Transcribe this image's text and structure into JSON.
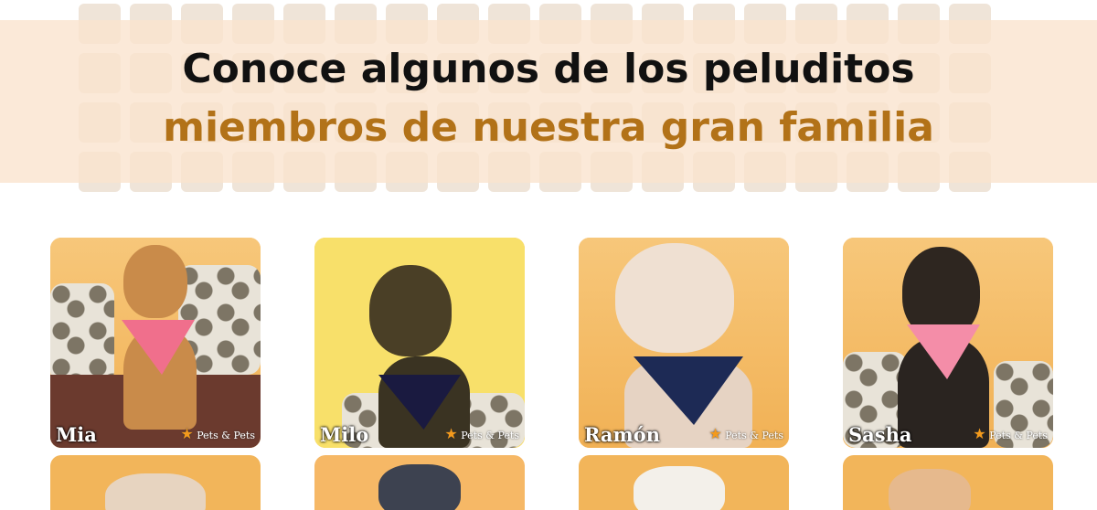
{
  "header": {
    "line1": "Conoce algunos de los peluditos",
    "line2": "miembros de nuestra gran familia"
  },
  "pets": [
    {
      "name": "Mia",
      "logo": "Pets & Pets"
    },
    {
      "name": "Milo",
      "logo": "Pets & Pets"
    },
    {
      "name": "Ramón",
      "logo": "Pets & Pets"
    },
    {
      "name": "Sasha",
      "logo": "Pets & Pets"
    }
  ],
  "colors": {
    "accent": "#b27218",
    "headline": "#111111",
    "card_background": "#f2b55a",
    "logo_mark": "#f39a1c"
  }
}
